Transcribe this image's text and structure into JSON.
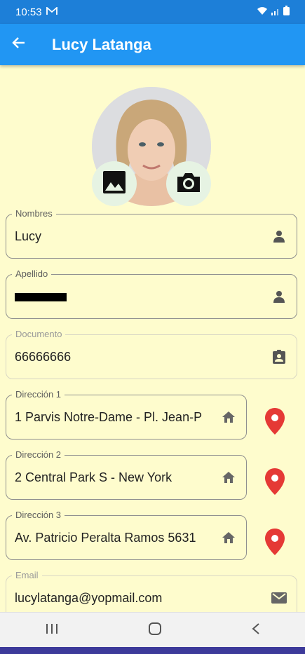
{
  "status_bar": {
    "time": "10:53",
    "battery_icon": "battery-icon",
    "wifi_icon": "wifi-icon",
    "signal_icon": "signal-icon"
  },
  "app_bar": {
    "title": "Lucy Latanga",
    "back_icon": "arrow-back-icon"
  },
  "avatar": {
    "gallery_icon": "image-icon",
    "camera_icon": "camera-icon"
  },
  "fields": {
    "nombres": {
      "label": "Nombres",
      "value": "Lucy",
      "icon": "person-icon"
    },
    "apellido": {
      "label": "Apellido",
      "value": "",
      "icon": "person-icon"
    },
    "documento": {
      "label": "Documento",
      "value": "66666666",
      "icon": "id-badge-icon"
    },
    "direccion1": {
      "label": "Dirección 1",
      "value": "1 Parvis Notre-Dame - Pl. Jean-P",
      "icon": "home-icon"
    },
    "direccion2": {
      "label": "Dirección 2",
      "value": "2 Central Park S - New York",
      "icon": "home-icon"
    },
    "direccion3": {
      "label": "Dirección 3",
      "value": "Av. Patricio Peralta Ramos 5631",
      "icon": "home-icon"
    },
    "email": {
      "label": "Email",
      "value": "lucylatanga@yopmail.com",
      "icon": "mail-icon"
    }
  },
  "colors": {
    "app_bar": "#2196f3",
    "status_bar": "#1d7fd8",
    "background": "#fefccd",
    "pin": "#e53935"
  }
}
